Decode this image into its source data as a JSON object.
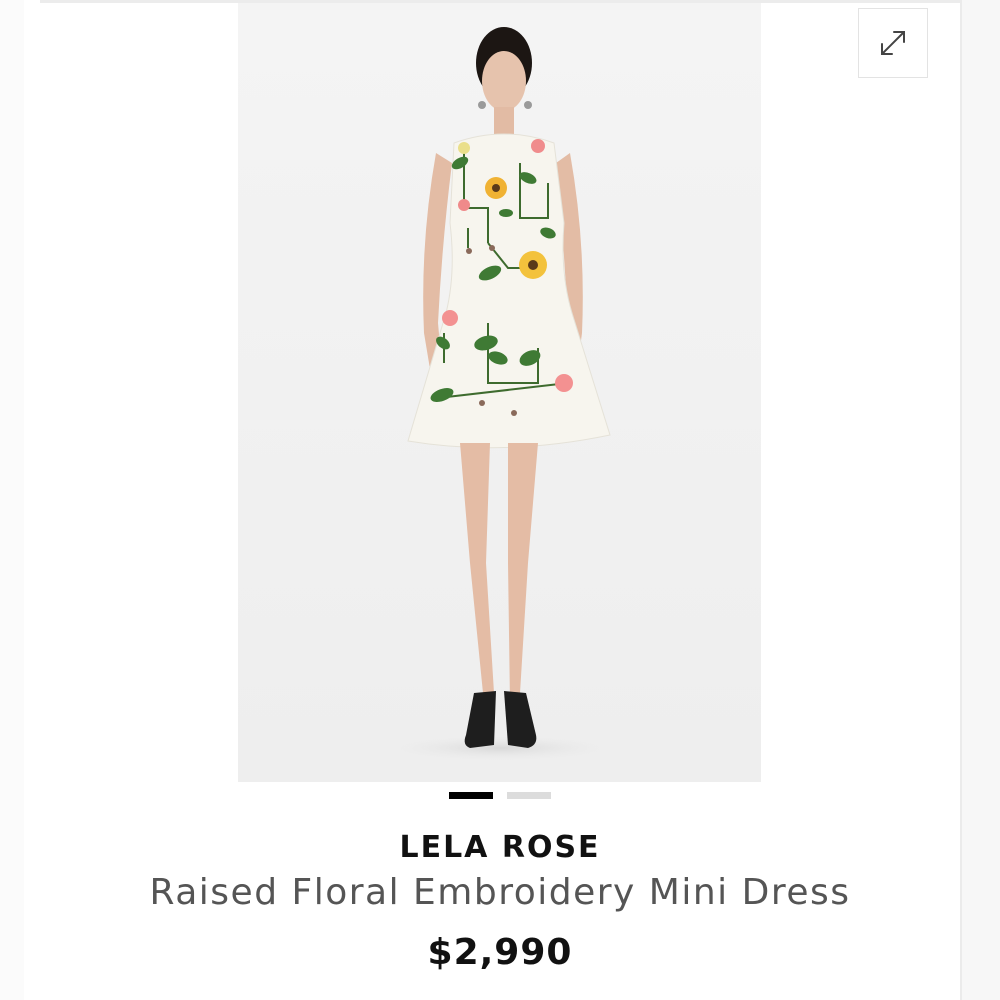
{
  "product": {
    "brand": "LELA ROSE",
    "name": "Raised Floral Embroidery Mini Dress",
    "price": "$2,990",
    "image_alt": "Model wearing white sleeveless mini dress with raised floral embroidery"
  },
  "gallery": {
    "image_count": 2,
    "active_index": 0,
    "expand_icon": "expand-arrows-icon"
  },
  "colors": {
    "active_dot": "#000000",
    "inactive_dot": "#dcdcdc",
    "title_text": "#555555"
  }
}
